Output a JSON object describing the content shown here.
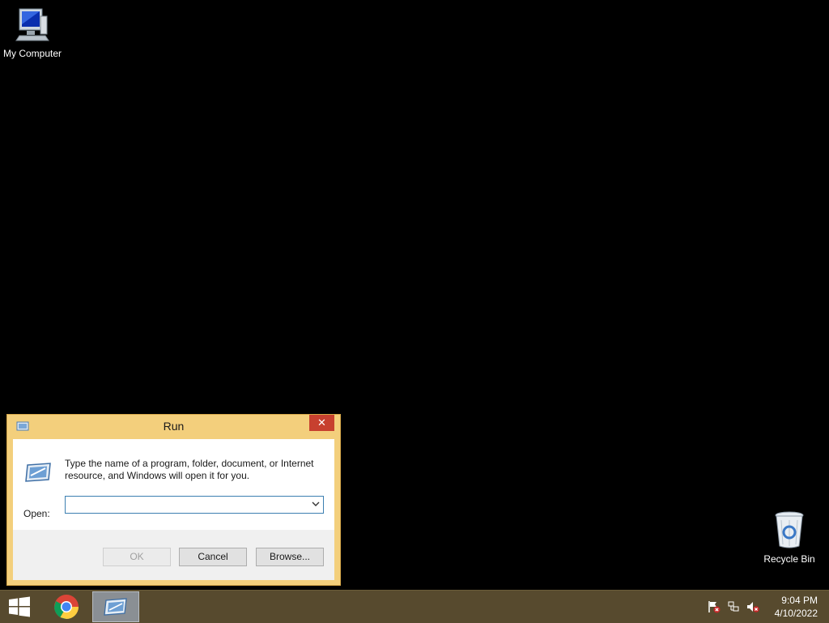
{
  "desktop": {
    "icons": [
      {
        "label": "My Computer",
        "icon": "computer-icon"
      },
      {
        "label": "Recycle Bin",
        "icon": "recycle-bin-icon"
      }
    ]
  },
  "run_dialog": {
    "title": "Run",
    "close_glyph": "✕",
    "description": "Type the name of a program, folder, document, or Internet resource, and Windows will open it for you.",
    "open_label": "Open:",
    "open_value": "",
    "buttons": {
      "ok": "OK",
      "cancel": "Cancel",
      "browse": "Browse..."
    },
    "colors": {
      "frame": "#f3cf7c",
      "close": "#c7402f"
    }
  },
  "taskbar": {
    "items": [
      "windows-start-icon",
      "chrome-icon",
      "run-icon"
    ],
    "tray": [
      "action-center-flag-icon",
      "network-icon",
      "volume-muted-icon"
    ],
    "time": "9:04 PM",
    "date": "4/10/2022",
    "color": "#574a2e"
  }
}
